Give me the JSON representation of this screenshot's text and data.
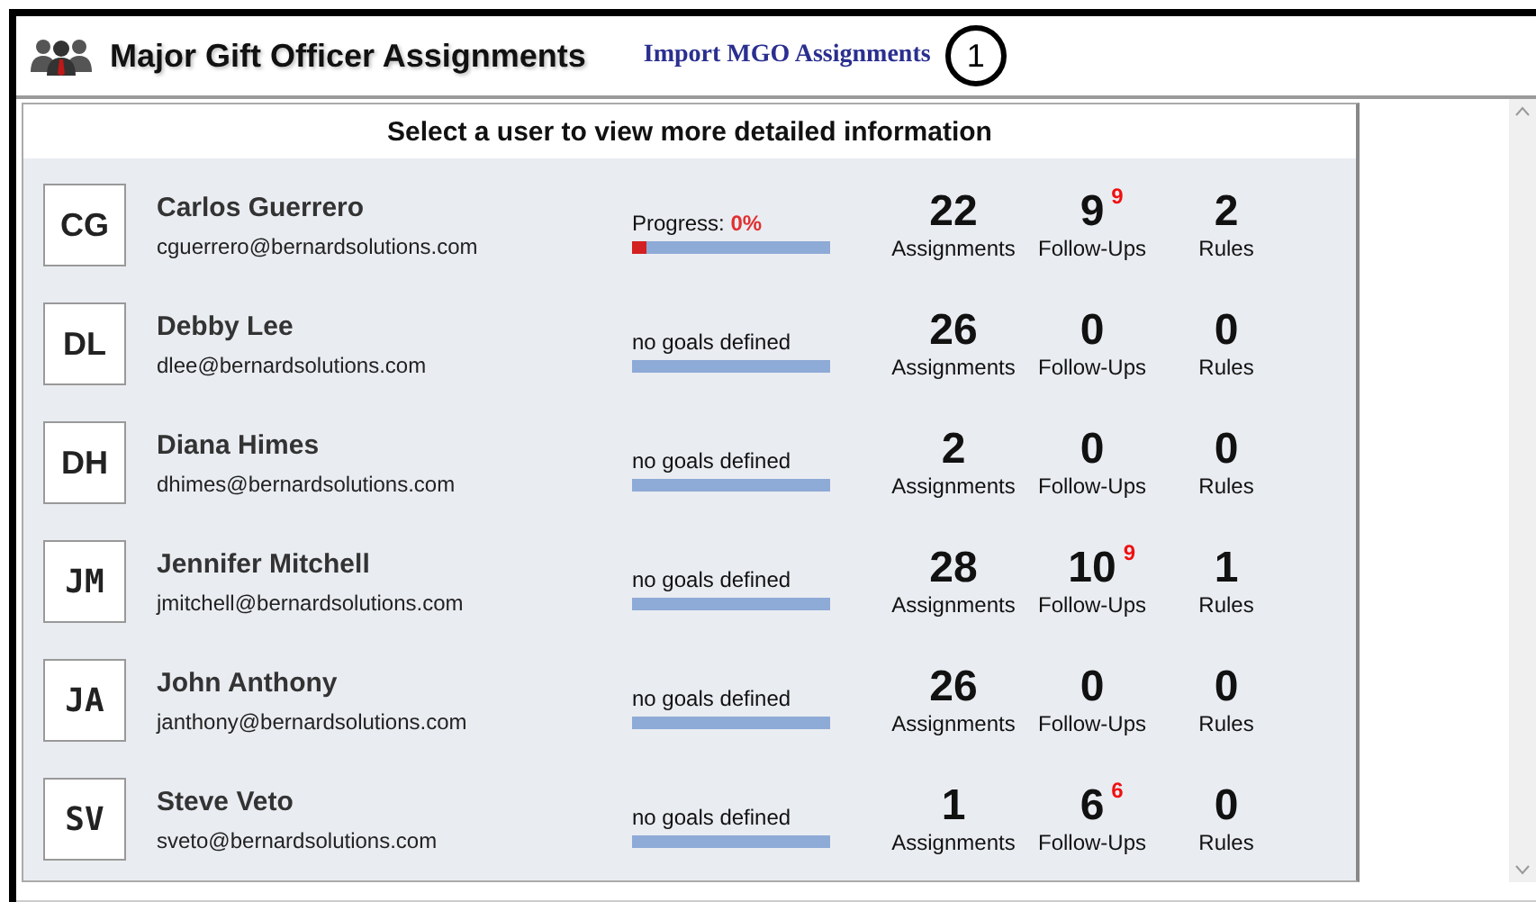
{
  "header": {
    "title": "Major Gift Officer Assignments",
    "link": "Import MGO Assignments",
    "callout": "1"
  },
  "panel": {
    "heading": "Select a user to view more detailed information",
    "users": [
      {
        "initials": "CG",
        "name": "Carlos Guerrero",
        "email": "cguerrero@bernardsolutions.com",
        "goal": {
          "kind": "progress",
          "label": "Progress:",
          "value": "0%",
          "level": 0
        },
        "stats": [
          {
            "value": "22",
            "label": "Assignments"
          },
          {
            "value": "9",
            "badge": "9",
            "label": "Follow-Ups"
          },
          {
            "value": "2",
            "label": "Rules"
          }
        ]
      },
      {
        "initials": "DL",
        "name": "Debby Lee",
        "email": "dlee@bernardsolutions.com",
        "goal": {
          "kind": "none",
          "text": "no goals defined"
        },
        "stats": [
          {
            "value": "26",
            "label": "Assignments"
          },
          {
            "value": "0",
            "label": "Follow-Ups"
          },
          {
            "value": "0",
            "label": "Rules"
          }
        ]
      },
      {
        "initials": "DH",
        "name": "Diana Himes",
        "email": "dhimes@bernardsolutions.com",
        "goal": {
          "kind": "none",
          "text": "no goals defined"
        },
        "stats": [
          {
            "value": "2",
            "label": "Assignments"
          },
          {
            "value": "0",
            "label": "Follow-Ups"
          },
          {
            "value": "0",
            "label": "Rules"
          }
        ]
      },
      {
        "initials": "JM",
        "name": "Jennifer Mitchell",
        "email": "jmitchell@bernardsolutions.com",
        "goal": {
          "kind": "none",
          "text": "no goals defined"
        },
        "stats": [
          {
            "value": "28",
            "label": "Assignments"
          },
          {
            "value": "10",
            "badge": "9",
            "label": "Follow-Ups"
          },
          {
            "value": "1",
            "label": "Rules"
          }
        ]
      },
      {
        "initials": "JA",
        "name": "John Anthony",
        "email": "janthony@bernardsolutions.com",
        "goal": {
          "kind": "none",
          "text": "no goals defined"
        },
        "stats": [
          {
            "value": "26",
            "label": "Assignments"
          },
          {
            "value": "0",
            "label": "Follow-Ups"
          },
          {
            "value": "0",
            "label": "Rules"
          }
        ]
      },
      {
        "initials": "SV",
        "name": "Steve Veto",
        "email": "sveto@bernardsolutions.com",
        "goal": {
          "kind": "none",
          "text": "no goals defined"
        },
        "stats": [
          {
            "value": "1",
            "label": "Assignments"
          },
          {
            "value": "6",
            "badge": "6",
            "label": "Follow-Ups"
          },
          {
            "value": "0",
            "label": "Rules"
          }
        ]
      }
    ]
  }
}
